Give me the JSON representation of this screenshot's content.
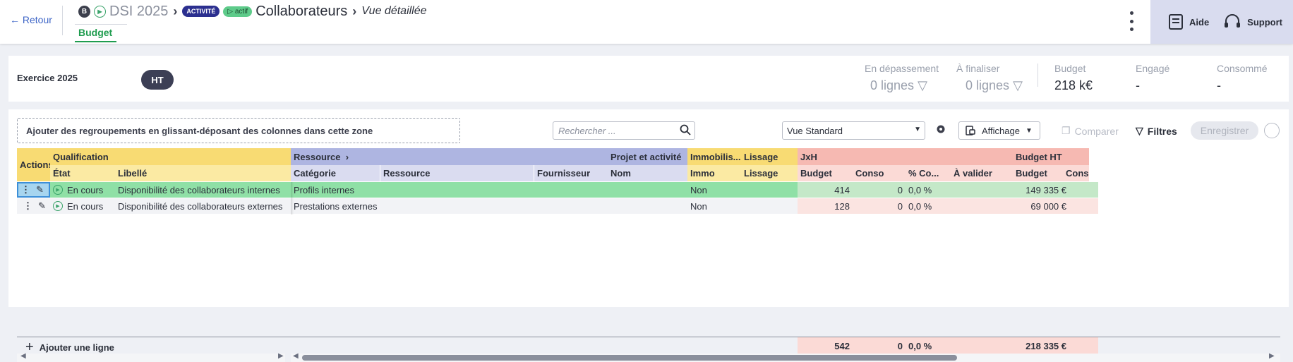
{
  "header": {
    "back_label": "Retour",
    "crumb_b": "B",
    "crumb_project": "DSI 2025",
    "badge_activite": "ACTIVITÉ",
    "badge_actif": "actif",
    "crumb_page": "Collaborateurs",
    "crumb_view": "Vue détaillée",
    "tab_budget": "Budget",
    "help_label": "Aide",
    "support_label": "Support"
  },
  "summary": {
    "exercice": "Exercice 2025",
    "ht": "HT",
    "depassement_label": "En dépassement",
    "depassement_val": "0  lignes",
    "finaliser_label": "À finaliser",
    "finaliser_val": "0  lignes",
    "budget_label": "Budget",
    "budget_val": "218 k€",
    "engage_label": "Engagé",
    "engage_val": "-",
    "consomme_label": "Consommé",
    "consomme_val": "-"
  },
  "toolbar": {
    "dropzone": "Ajouter des regroupements en glissant-déposant des colonnes dans cette zone",
    "search_placeholder": "Rechercher ...",
    "view": "Vue Standard",
    "affichage": "Affichage",
    "comparer": "Comparer",
    "filtres": "Filtres",
    "enregistrer": "Enregistrer"
  },
  "groups": {
    "actions": "Actions",
    "qualification": "Qualification",
    "ressource": "Ressource",
    "projet": "Projet et activité",
    "immo": "Immobilis...",
    "lissage": "Lissage",
    "jxh": "JxH",
    "budget_ht": "Budget HT"
  },
  "columns": {
    "etat": "État",
    "libelle": "Libellé",
    "categorie": "Catégorie",
    "ressource": "Ressource",
    "fournisseur": "Fournisseur",
    "nom": "Nom",
    "immo": "Immo",
    "lissage": "Lissage",
    "budget": "Budget",
    "conso": "Conso",
    "pct": "% Co...",
    "avalider": "À valider",
    "budget2": "Budget",
    "conso2": "Conso"
  },
  "rows": [
    {
      "etat": "En cours",
      "libelle": "Disponibilité des collaborateurs internes",
      "categorie": "Profils internes",
      "immo": "Non",
      "budget": "414",
      "conso": "0",
      "pct": "0,0 %",
      "budget_ht": "149 335 €"
    },
    {
      "etat": "En cours",
      "libelle": "Disponibilité des collaborateurs externes",
      "categorie": "Prestations externes",
      "immo": "Non",
      "budget": "128",
      "conso": "0",
      "pct": "0,0 %",
      "budget_ht": "69 000 €"
    }
  ],
  "footer": {
    "add_line": "Ajouter une ligne",
    "tot_budget": "542",
    "tot_conso": "0",
    "tot_pct": "0,0 %",
    "tot_budget_ht": "218 335 €"
  }
}
